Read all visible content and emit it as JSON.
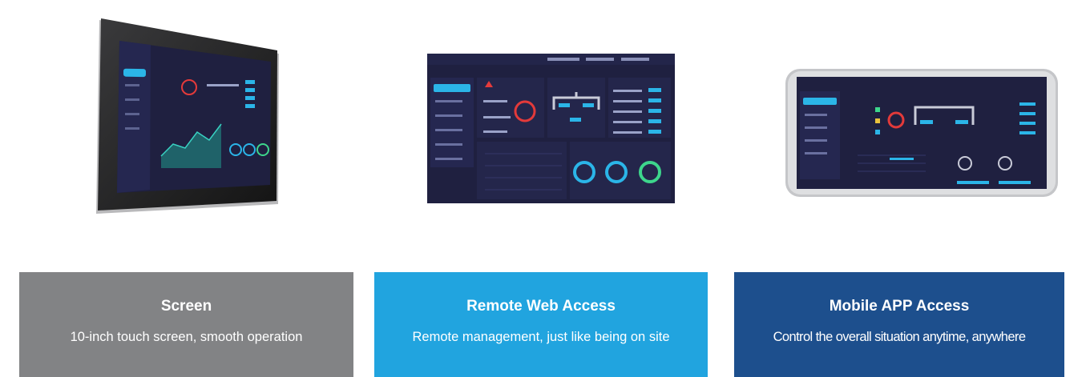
{
  "colors": {
    "screen_panel": "#828385",
    "web_panel": "#21a4df",
    "mobile_panel": "#1d4f8d",
    "ui_background": "#1f2040",
    "ui_accent": "#2bb5e8"
  },
  "devices": [
    {
      "name": "tablet",
      "illustration": "touch-screen-dashboard"
    },
    {
      "name": "web-browser",
      "illustration": "web-dashboard"
    },
    {
      "name": "phone",
      "illustration": "mobile-app-dashboard"
    }
  ],
  "panels": [
    {
      "title": "Screen",
      "description": "10-inch touch screen, smooth operation"
    },
    {
      "title": "Remote Web Access",
      "description": "Remote management, just like being on site"
    },
    {
      "title": "Mobile APP Access",
      "description": "Control the overall situation anytime, anywhere"
    }
  ]
}
